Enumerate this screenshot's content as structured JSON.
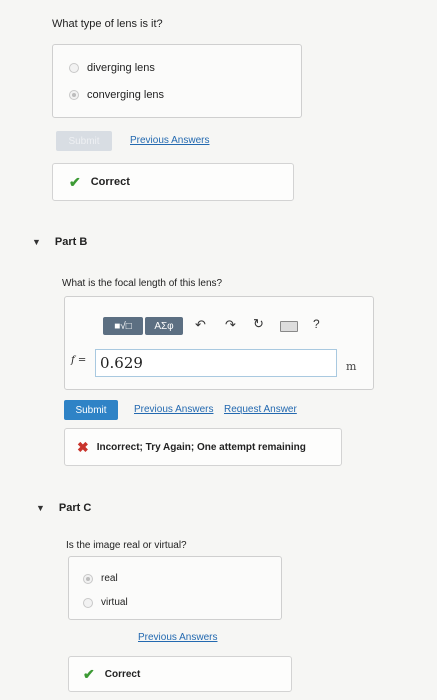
{
  "part_a": {
    "question": "What type of lens is it?",
    "options": [
      {
        "label": "diverging lens",
        "selected": false
      },
      {
        "label": "converging lens",
        "selected": true
      }
    ],
    "submit_label": "Submit",
    "previous_answers_label": "Previous Answers",
    "feedback": "Correct"
  },
  "part_b": {
    "title": "Part B",
    "question": "What is the focal length of this lens?",
    "toolbar": {
      "templates_label": "■√□",
      "symbols_label": "AΣφ",
      "undo_icon": "undo-icon",
      "redo_icon": "redo-icon",
      "reset_icon": "reset-icon",
      "keyboard_icon": "keyboard-icon",
      "help_label": "?"
    },
    "variable_label": "f =",
    "answer_value": "0.629",
    "unit": "m",
    "submit_label": "Submit",
    "previous_answers_label": "Previous Answers",
    "request_answer_label": "Request Answer",
    "feedback": "Incorrect; Try Again; One attempt remaining"
  },
  "part_c": {
    "title": "Part C",
    "question": "Is the image real or virtual?",
    "options": [
      {
        "label": "real",
        "selected": true
      },
      {
        "label": "virtual",
        "selected": false
      }
    ],
    "previous_answers_label": "Previous Answers",
    "feedback": "Correct"
  },
  "colors": {
    "accent": "#2f83c6",
    "link": "#2369b0",
    "correct": "#3c9a34",
    "incorrect": "#c9342c"
  }
}
